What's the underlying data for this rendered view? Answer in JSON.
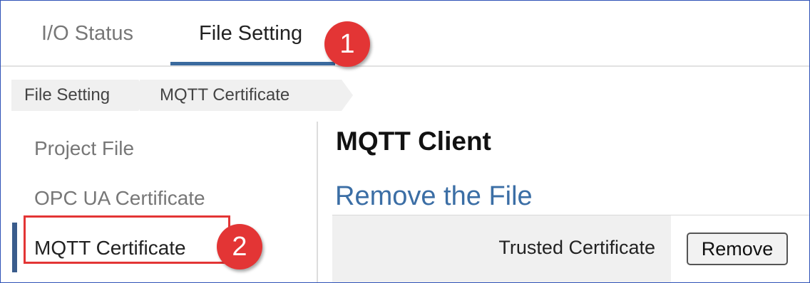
{
  "tabs": [
    {
      "label": "I/O Status"
    },
    {
      "label": "File Setting",
      "active": true
    }
  ],
  "badges": [
    "1",
    "2"
  ],
  "breadcrumb": [
    "File Setting",
    "MQTT Certificate"
  ],
  "sidebar": {
    "items": [
      {
        "label": "Project File"
      },
      {
        "label": "OPC UA Certificate"
      },
      {
        "label": "MQTT Certificate",
        "active": true
      }
    ]
  },
  "main": {
    "title": "MQTT Client",
    "section_title": "Remove the File",
    "rows": [
      {
        "label": "Trusted Certificate",
        "button": "Remove"
      }
    ]
  },
  "colors": {
    "accent": "#3a6a9e",
    "section_title": "#3b6ea5",
    "badge": "#e33535",
    "frame_border": "#2f52b7"
  }
}
